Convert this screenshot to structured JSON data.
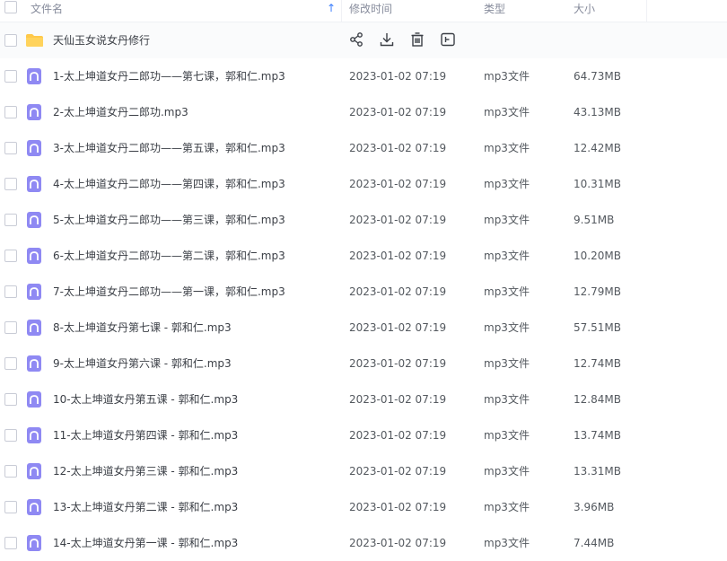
{
  "columns": {
    "name": "文件名",
    "modified": "修改时间",
    "type": "类型",
    "size": "大小"
  },
  "folder": {
    "name": "天仙玉女说女丹修行",
    "actions": [
      "share-icon",
      "download-icon",
      "delete-icon",
      "more-icon"
    ]
  },
  "files": [
    {
      "name": "1-太上坤道女丹二郎功——第七课，郭和仁.mp3",
      "time": "2023-01-02 07:19",
      "type": "mp3文件",
      "size": "64.73MB"
    },
    {
      "name": "2-太上坤道女丹二郎功.mp3",
      "time": "2023-01-02 07:19",
      "type": "mp3文件",
      "size": "43.13MB"
    },
    {
      "name": "3-太上坤道女丹二郎功——第五课，郭和仁.mp3",
      "time": "2023-01-02 07:19",
      "type": "mp3文件",
      "size": "12.42MB"
    },
    {
      "name": "4-太上坤道女丹二郎功——第四课，郭和仁.mp3",
      "time": "2023-01-02 07:19",
      "type": "mp3文件",
      "size": "10.31MB"
    },
    {
      "name": "5-太上坤道女丹二郎功——第三课，郭和仁.mp3",
      "time": "2023-01-02 07:19",
      "type": "mp3文件",
      "size": "9.51MB"
    },
    {
      "name": "6-太上坤道女丹二郎功——第二课，郭和仁.mp3",
      "time": "2023-01-02 07:19",
      "type": "mp3文件",
      "size": "10.20MB"
    },
    {
      "name": "7-太上坤道女丹二郎功——第一课，郭和仁.mp3",
      "time": "2023-01-02 07:19",
      "type": "mp3文件",
      "size": "12.79MB"
    },
    {
      "name": "8-太上坤道女丹第七课 - 郭和仁.mp3",
      "time": "2023-01-02 07:19",
      "type": "mp3文件",
      "size": "57.51MB"
    },
    {
      "name": "9-太上坤道女丹第六课 - 郭和仁.mp3",
      "time": "2023-01-02 07:19",
      "type": "mp3文件",
      "size": "12.74MB"
    },
    {
      "name": "10-太上坤道女丹第五课 - 郭和仁.mp3",
      "time": "2023-01-02 07:19",
      "type": "mp3文件",
      "size": "12.84MB"
    },
    {
      "name": "11-太上坤道女丹第四课 - 郭和仁.mp3",
      "time": "2023-01-02 07:19",
      "type": "mp3文件",
      "size": "13.74MB"
    },
    {
      "name": "12-太上坤道女丹第三课 - 郭和仁.mp3",
      "time": "2023-01-02 07:19",
      "type": "mp3文件",
      "size": "13.31MB"
    },
    {
      "name": "13-太上坤道女丹第二课 - 郭和仁.mp3",
      "time": "2023-01-02 07:19",
      "type": "mp3文件",
      "size": "3.96MB"
    },
    {
      "name": "14-太上坤道女丹第一课 - 郭和仁.mp3",
      "time": "2023-01-02 07:19",
      "type": "mp3文件",
      "size": "7.44MB"
    }
  ],
  "colors": {
    "accent": "#3a7dfc",
    "audio_icon": "#8f89f3",
    "folder_icon": "#ffc94a"
  }
}
